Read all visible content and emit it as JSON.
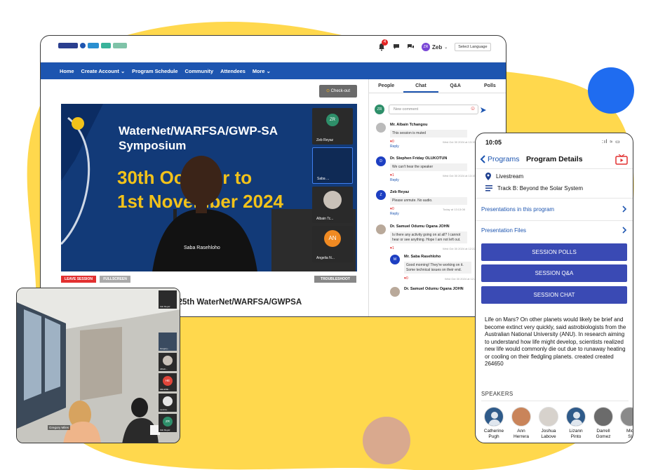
{
  "colors": {
    "yellow": "#ffd84d",
    "brand_blue": "#1d55b0",
    "phone_button": "#3a4ab4",
    "leave_red": "#e23030"
  },
  "desktop": {
    "header": {
      "notification_count": "4",
      "user_initials": "ZR",
      "user_name": "Zeb",
      "language_button": "Select Language"
    },
    "nav": [
      "Home",
      "Create Account",
      "Program Schedule",
      "Community",
      "Attendees",
      "More"
    ],
    "checkout_label": "Check-out",
    "video": {
      "banner_title": "WaterNet/WARFSA/GWP-SA Symposium",
      "banner_date_1": "30th October to",
      "banner_date_2": "1st November 2024",
      "speaker_label": "Saba Rasehloho",
      "tiles": [
        {
          "initials": "ZR",
          "name": "Zeb Reyaz"
        },
        {
          "initials": "",
          "name": "Saba ..."
        },
        {
          "initials": "",
          "name": "Albain Tc..."
        },
        {
          "initials": "AN",
          "name": "Angelia N..."
        }
      ]
    },
    "controls": {
      "leave": "LEAVE SESSION",
      "fullscreen": "FULLSCREEN",
      "troubleshoot": "TROUBLESHOOT"
    },
    "session_title": "e 25th WaterNet/WARFSA/GWPSA"
  },
  "chat": {
    "tabs": [
      "People",
      "Chat",
      "Q&A",
      "Polls"
    ],
    "active_tab": "Chat",
    "comment_placeholder": "New comment",
    "messages": [
      {
        "name": "Mr. Albain Tchangou",
        "text": "This session is muted",
        "likes": "0",
        "date": "Wed Oct 30 2024 at 13:15",
        "reply": "Reply"
      },
      {
        "name": "Dr. Stephen Friday OLUKOTUN",
        "text": "We can't hear the speaker",
        "likes": "1",
        "date": "Wed Oct 30 2024 at 13:15",
        "reply": "Reply"
      },
      {
        "name": "Zeb Reyaz",
        "text": "Please unmute. No audio.",
        "likes": "0",
        "date": "Today at 13:13:08",
        "reply": "Reply"
      },
      {
        "name": "Dr. Samuel Odumu Ogana JOHN",
        "text": "Is there any activity going on at all? I cannot hear or see anything. Hope I am not left out.",
        "likes": "1",
        "date": "Wed Oct 30 2024 at 12:22",
        "reply": ""
      },
      {
        "name": "Mr. Saba Rasehloho",
        "text": "Good morning! They're working on it. Some technical issues on their end.",
        "likes": "0",
        "date": "Wed Oct 30 2024 at 12:24",
        "reply": ""
      },
      {
        "name": "Dr. Samuel Odumu Ogana JOHN",
        "text": "",
        "likes": "",
        "date": "",
        "reply": ""
      }
    ]
  },
  "zoom": {
    "main_label": "Gregory Miles",
    "tiles": [
      {
        "initials": "",
        "name": "Zeb Reyaz"
      },
      {
        "initials": "",
        "name": "Gregory..."
      },
      {
        "initials": "",
        "name": "Albain..."
      },
      {
        "initials": "HE",
        "name": "HELENE..."
      },
      {
        "initials": "",
        "name": "Lavinia..."
      },
      {
        "initials": "ZR",
        "name": "Zeb Reyaz"
      }
    ]
  },
  "phone": {
    "time": "10:05",
    "status": ":ıl ≈ ▭",
    "back_label": "Programs",
    "title": "Program Details",
    "livestream": "Livestream",
    "track": "Track B: Beyond the Solar System",
    "links": [
      "Presentations in this program",
      "Presentation Files"
    ],
    "buttons": [
      "SESSION POLLS",
      "SESSION Q&A",
      "SESSION CHAT"
    ],
    "description": "Life on Mars? On other planets would likely be brief and become extinct very quickly, said astrobiologists from the Australian National University (ANU). In research aiming to understand how life might develop, scientists realized new life would commonly die out due to runaway heating or cooling on their fledgling planets. created created 264650",
    "speakers_heading": "SPEAKERS",
    "speakers": [
      {
        "first": "Catherine",
        "last": "Pugh"
      },
      {
        "first": "Ann",
        "last": "Herrera"
      },
      {
        "first": "Joshua",
        "last": "Labove"
      },
      {
        "first": "Lizann",
        "last": "Pinto"
      },
      {
        "first": "Darrell",
        "last": "Gomez"
      },
      {
        "first": "Mic",
        "last": "Sl"
      }
    ]
  }
}
